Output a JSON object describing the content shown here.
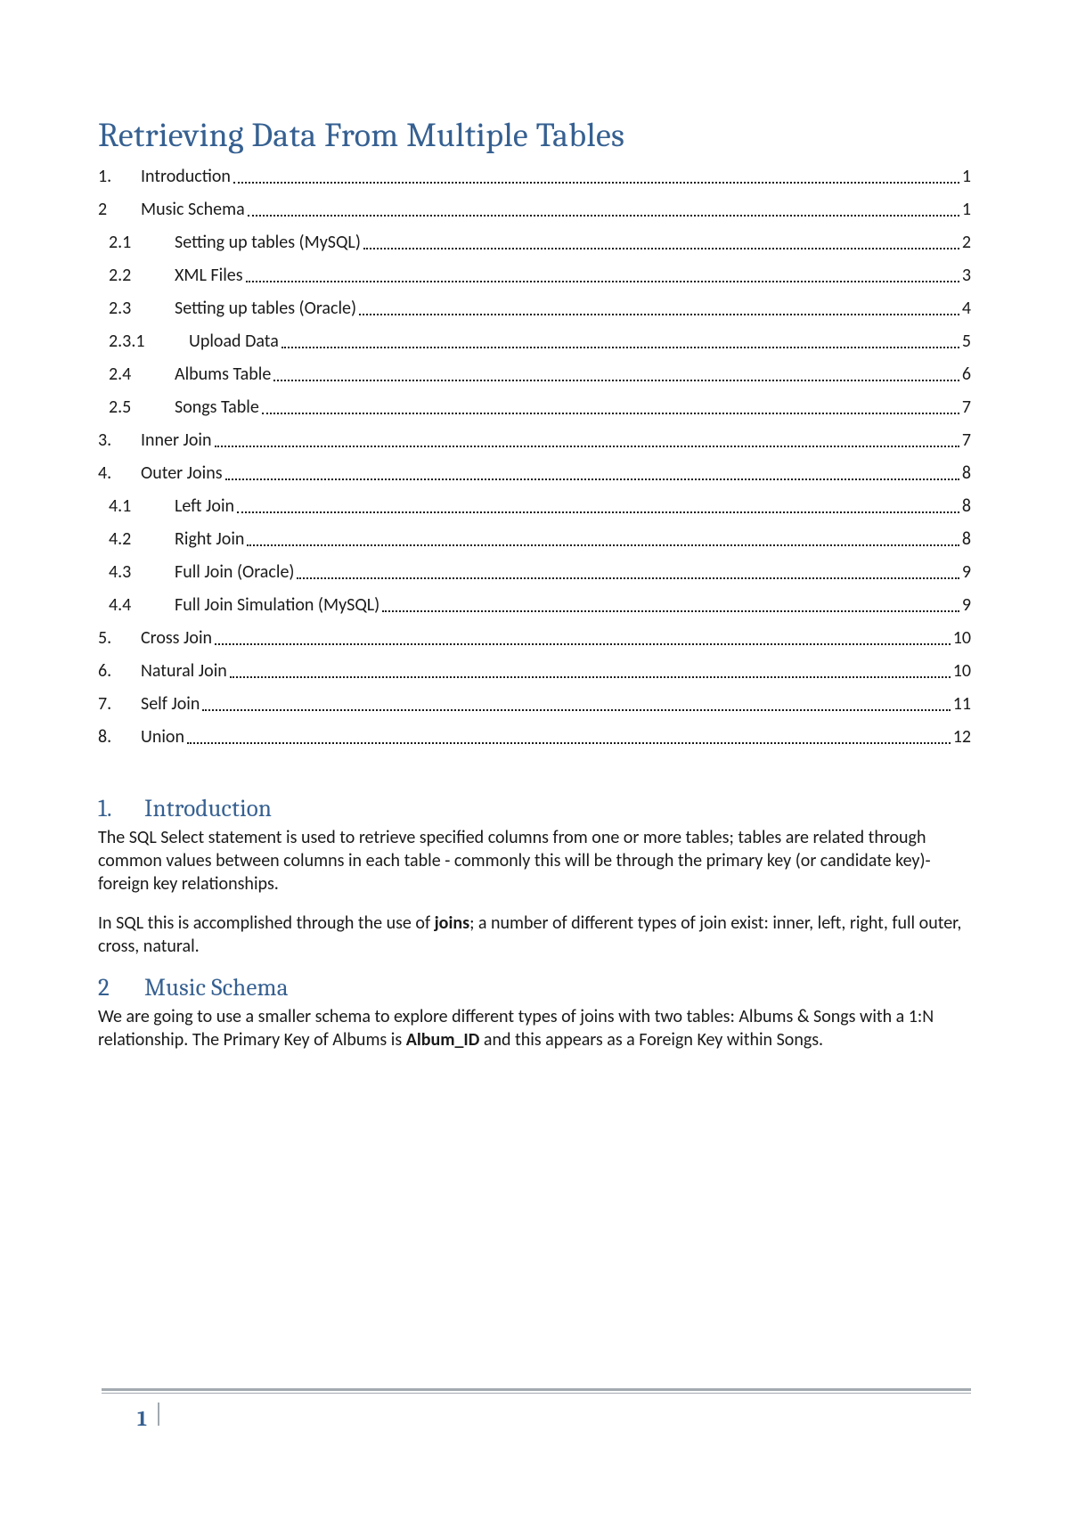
{
  "title": "Retrieving Data From Multiple Tables",
  "toc": [
    {
      "level": 1,
      "num": "1.",
      "text": "Introduction",
      "page": "1"
    },
    {
      "level": 1,
      "num": "2",
      "text": "Music Schema",
      "page": "1"
    },
    {
      "level": 2,
      "num": "2.1",
      "text": "Setting up tables (MySQL)",
      "page": "2"
    },
    {
      "level": 2,
      "num": "2.2",
      "text": "XML Files",
      "page": "3"
    },
    {
      "level": 2,
      "num": "2.3",
      "text": "Setting up tables (Oracle)",
      "page": "4"
    },
    {
      "level": 3,
      "num": "2.3.1",
      "text": "Upload Data",
      "page": "5"
    },
    {
      "level": 2,
      "num": "2.4",
      "text": "Albums Table",
      "page": "6"
    },
    {
      "level": 2,
      "num": "2.5",
      "text": "Songs Table",
      "page": "7"
    },
    {
      "level": 1,
      "num": "3.",
      "text": "Inner Join",
      "page": "7"
    },
    {
      "level": 1,
      "num": "4.",
      "text": "Outer Joins",
      "page": "8"
    },
    {
      "level": 2,
      "num": "4.1",
      "text": "Left Join",
      "page": "8"
    },
    {
      "level": 2,
      "num": "4.2",
      "text": "Right Join",
      "page": "8"
    },
    {
      "level": 2,
      "num": "4.3",
      "text": "Full Join (Oracle)",
      "page": "9"
    },
    {
      "level": 2,
      "num": "4.4",
      "text": "Full Join Simulation (MySQL)",
      "page": "9"
    },
    {
      "level": 1,
      "num": "5.",
      "text": "Cross Join",
      "page": "10"
    },
    {
      "level": 1,
      "num": "6.",
      "text": "Natural Join",
      "page": "10"
    },
    {
      "level": 1,
      "num": "7.",
      "text": "Self Join",
      "page": "11"
    },
    {
      "level": 1,
      "num": "8.",
      "text": "Union",
      "page": "12"
    }
  ],
  "sections": {
    "intro": {
      "num": "1.",
      "title": "Introduction",
      "p1_a": "The SQL Select statement is used to retrieve specified columns from one or more tables; tables are related through common values between columns in each table - commonly this will be through the primary key (or candidate key)-foreign key relationships.",
      "p2_a": "In SQL this is accomplished through the use of ",
      "p2_bold": "joins",
      "p2_b": "; a number of different types of join exist: inner, left, right, full outer, cross, natural."
    },
    "schema": {
      "num": "2",
      "title": "Music Schema",
      "p1_a": "We are going to use a smaller schema to explore different types of joins with two tables: Albums & Songs with a 1:N relationship. The Primary Key of Albums is ",
      "p1_bold": "Album_ID",
      "p1_b": " and this appears as a Foreign Key within Songs."
    }
  },
  "footer": {
    "page": "1"
  }
}
